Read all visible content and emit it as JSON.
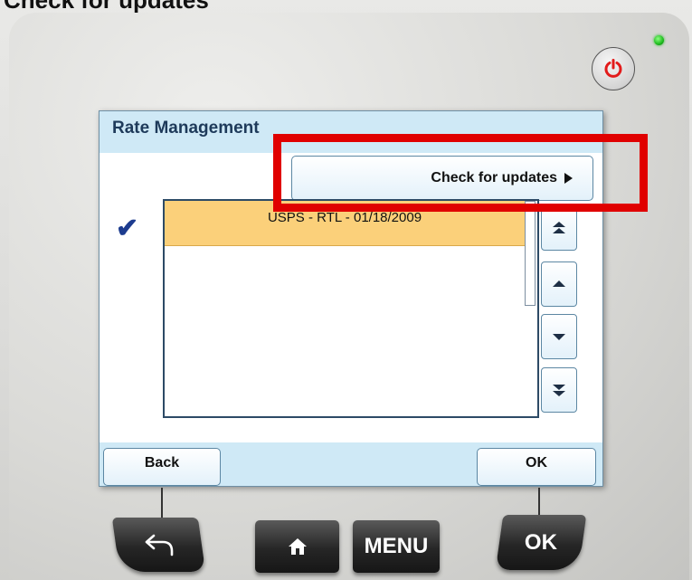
{
  "caption": "Check for updates",
  "screen": {
    "title": "Rate Management",
    "check_updates_label": "Check for updates",
    "rates": [
      {
        "label": "USPS - RTL - 01/18/2009",
        "selected": true
      }
    ],
    "back_label": "Back",
    "ok_label": "OK"
  },
  "hardware_keys": {
    "back_icon": "back-arrow-icon",
    "home_icon": "home-icon",
    "menu_label": "MENU",
    "ok_label": "OK"
  },
  "colors": {
    "highlight": "#e00000",
    "header": "#cfe9f6",
    "selected_row": "#fbd07a",
    "power_icon": "#e21b1b",
    "status_led": "#1dbb1d"
  }
}
